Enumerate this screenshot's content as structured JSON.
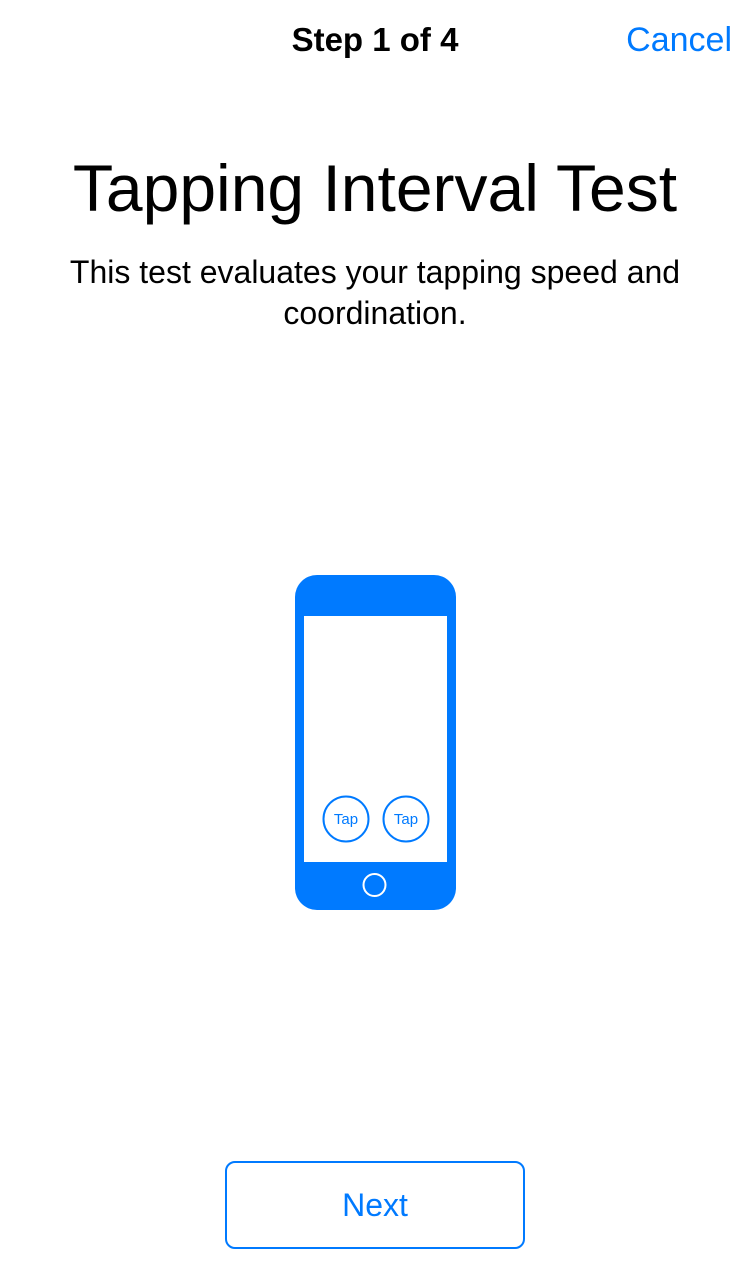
{
  "nav": {
    "step_label": "Step 1 of 4",
    "cancel_label": "Cancel"
  },
  "main": {
    "title": "Tapping Interval Test",
    "subtitle": "This test evaluates your tapping speed and coordination."
  },
  "illustration": {
    "icon": "phone-tap-icon",
    "tap_left_label": "Tap",
    "tap_right_label": "Tap"
  },
  "footer": {
    "next_label": "Next"
  },
  "colors": {
    "accent": "#007aff",
    "background": "#ffffff",
    "text": "#000000"
  }
}
